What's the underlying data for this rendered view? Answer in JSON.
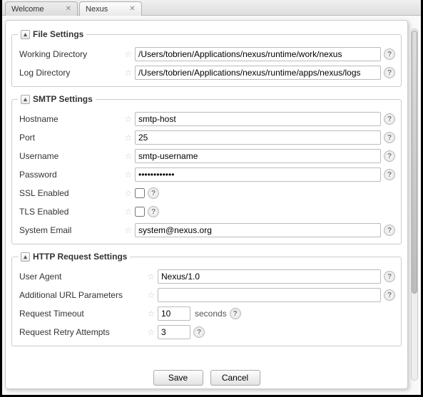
{
  "tabs": {
    "welcome": "Welcome",
    "nexus": "Nexus"
  },
  "file_settings": {
    "legend": "File Settings",
    "working_dir_label": "Working Directory",
    "working_dir_value": "/Users/tobrien/Applications/nexus/runtime/work/nexus",
    "log_dir_label": "Log Directory",
    "log_dir_value": "/Users/tobrien/Applications/nexus/runtime/apps/nexus/logs"
  },
  "smtp_settings": {
    "legend": "SMTP Settings",
    "hostname_label": "Hostname",
    "hostname_value": "smtp-host",
    "port_label": "Port",
    "port_value": "25",
    "username_label": "Username",
    "username_value": "smtp-username",
    "password_label": "Password",
    "password_value": "••••••••••••",
    "ssl_label": "SSL Enabled",
    "tls_label": "TLS Enabled",
    "system_email_label": "System Email",
    "system_email_value": "system@nexus.org"
  },
  "http_settings": {
    "legend": "HTTP Request Settings",
    "user_agent_label": "User Agent",
    "user_agent_value": "Nexus/1.0",
    "addl_params_label": "Additional URL Parameters",
    "addl_params_value": "",
    "timeout_label": "Request Timeout",
    "timeout_value": "10",
    "timeout_suffix": "seconds",
    "retry_label": "Request Retry Attempts",
    "retry_value": "3"
  },
  "buttons": {
    "save": "Save",
    "cancel": "Cancel"
  }
}
